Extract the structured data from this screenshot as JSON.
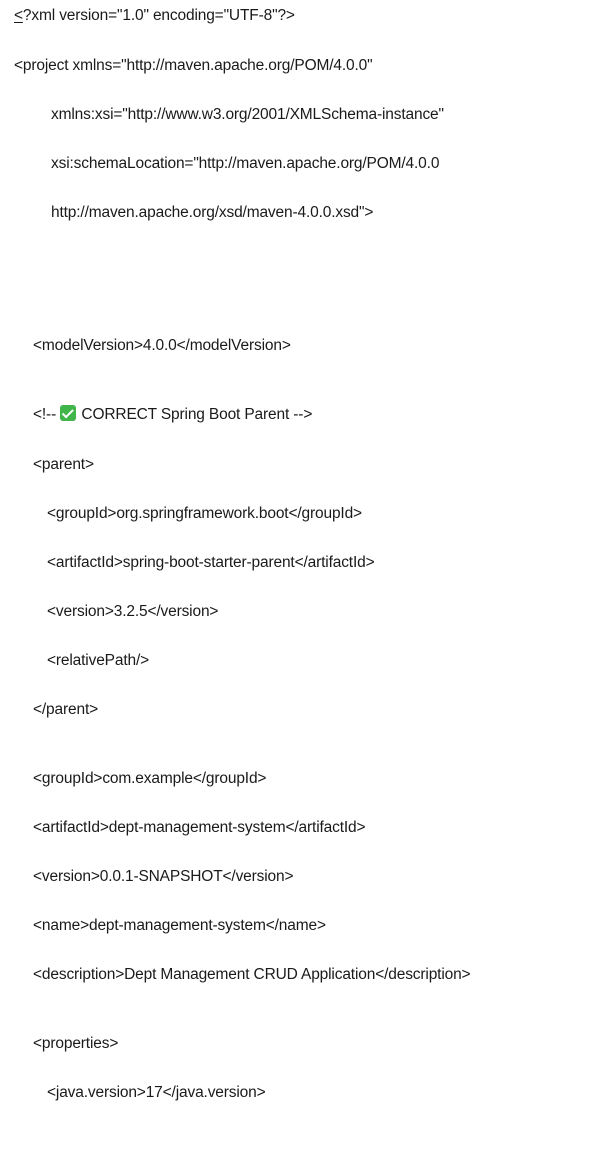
{
  "document": {
    "lines": [
      {
        "first": "<",
        "text": "?xml version=\"1.0\" encoding=\"UTF-8\"?>"
      },
      {
        "text": "<project xmlns=\"http://maven.apache.org/POM/4.0.0\""
      },
      {
        "text": "xmlns:xsi=\"http://www.w3.org/2001/XMLSchema-instance\""
      },
      {
        "text": "xsi:schemaLocation=\"http://maven.apache.org/POM/4.0.0"
      },
      {
        "text": "http://maven.apache.org/xsd/maven-4.0.0.xsd\">"
      },
      {
        "text": "<modelVersion>4.0.0</modelVersion>"
      },
      {
        "before": "<!-- ",
        "icon": "check-icon",
        "after": " CORRECT Spring Boot Parent -->"
      },
      {
        "text": "<parent>"
      },
      {
        "text": "<groupId>org.springframework.boot</groupId>"
      },
      {
        "text": "<artifactId>spring-boot-starter-parent</artifactId>"
      },
      {
        "text": "<version>3.2.5</version>"
      },
      {
        "text": "<relativePath/>"
      },
      {
        "text": "</parent>"
      },
      {
        "text": "<groupId>com.example</groupId>"
      },
      {
        "text": "<artifactId>dept-management-system</artifactId>"
      },
      {
        "text": "<version>0.0.1-SNAPSHOT</version>"
      },
      {
        "text": "<name>dept-management-system</name>"
      },
      {
        "text": "<description>Dept Management CRUD Application</description>"
      },
      {
        "text": "<properties>"
      },
      {
        "text": "<java.version>17</java.version>"
      }
    ]
  },
  "colors": {
    "text": "#1a1a1a",
    "background": "#ffffff",
    "check_icon": "#3fb54a"
  }
}
